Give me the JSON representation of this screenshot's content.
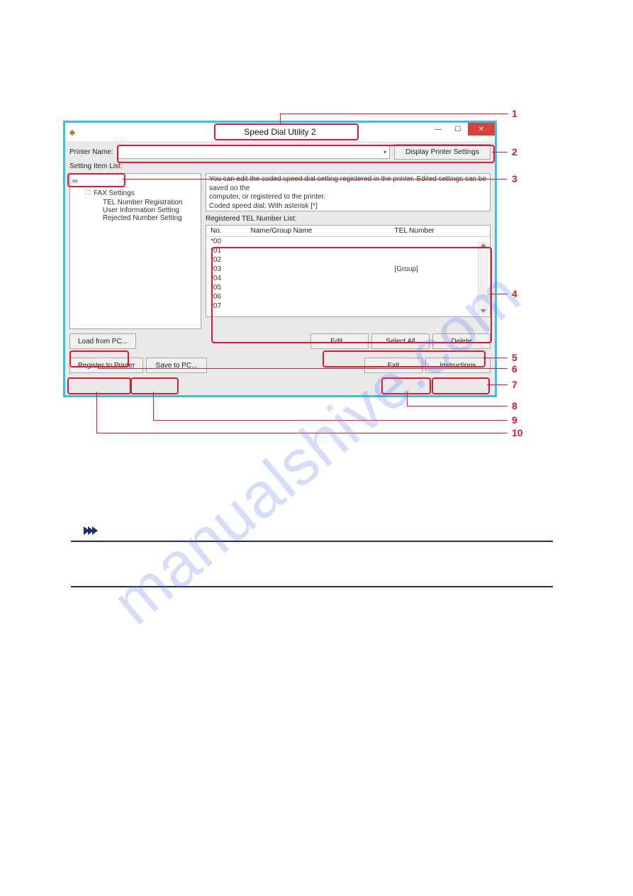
{
  "watermark": "manualshive.com",
  "window": {
    "title": "Speed Dial Utility 2",
    "printer_name_label": "Printer Name:",
    "printer_name_value": "",
    "display_settings_btn": "Display Printer Settings",
    "setting_item_list_label": "Setting Item List:",
    "tree": {
      "root": "",
      "fax": "FAX Settings",
      "leaves": [
        "TEL Number Registration",
        "User Information Setting",
        "Rejected Number Setting"
      ]
    },
    "desc_line1": "You can edit the coded speed dial setting registered in the printer. Edited settings can be saved on the",
    "desc_line2": "computer, or registered to the printer.",
    "desc_line3": "Coded speed dial: With asterisk [*]",
    "registered_label": "Registered TEL Number List:",
    "grid": {
      "headers": {
        "no": "No.",
        "name": "Name/Group Name",
        "tel": "TEL Number"
      },
      "rows": [
        {
          "no": "*00",
          "name": "",
          "tel": ""
        },
        {
          "no": "*01",
          "name": "",
          "tel": ""
        },
        {
          "no": "*02",
          "name": "",
          "tel": ""
        },
        {
          "no": "*03",
          "name": "",
          "tel": "[Group]"
        },
        {
          "no": "*04",
          "name": "",
          "tel": ""
        },
        {
          "no": "*05",
          "name": "",
          "tel": ""
        },
        {
          "no": "*06",
          "name": "",
          "tel": ""
        },
        {
          "no": "*07",
          "name": "",
          "tel": ""
        }
      ]
    },
    "buttons": {
      "load_from_pc": "Load from PC...",
      "edit": "Edit...",
      "select_all": "Select All",
      "delete": "Delete",
      "register_to_printer": "Register to Printer",
      "save_to_pc": "Save to PC...",
      "exit": "Exit",
      "instructions": "Instructions"
    }
  },
  "callout_numbers": {
    "n1": "1",
    "n2": "2",
    "n3": "3",
    "n4": "4",
    "n5": "5",
    "n6": "6",
    "n7": "7",
    "n8": "8",
    "n9": "9",
    "n10": "10"
  }
}
